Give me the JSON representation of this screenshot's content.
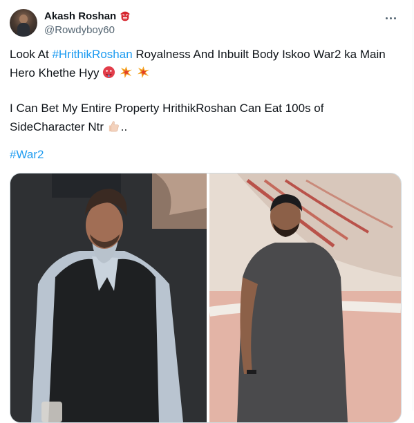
{
  "tweet": {
    "display_name": "Akash Roshan",
    "handle": "@Rowdyboy60",
    "more_icon": "more-horizontal-icon",
    "text": {
      "line1_prefix": "Look At ",
      "line1_hashtag": "#HrithikRoshan",
      "line1_suffix": " Royalness And Inbuilt Body Iskoo War2 ka Main",
      "line2": "Hero Khethe Hyy",
      "line3": "I Can Bet My Entire Property HrithikRoshan Can Eat 100s of",
      "line4": "SideCharacter Ntr",
      "line4_suffix": "..",
      "hashtag_war2": "#War2"
    },
    "emojis": [
      "goblin-emoji",
      "hot-face-emoji",
      "collision-emoji",
      "collision-emoji",
      "thumbs-up-emoji"
    ],
    "colors": {
      "link": "#1d9bf0",
      "text": "#0f1419",
      "muted": "#536471"
    }
  }
}
